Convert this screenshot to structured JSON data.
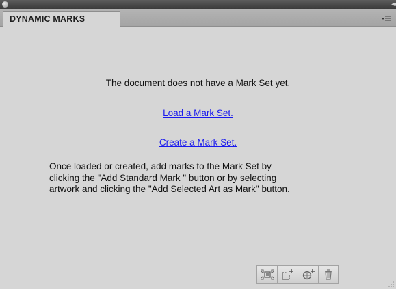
{
  "panel": {
    "tab_title": "DYNAMIC MARKS"
  },
  "content": {
    "message": "The document does not have a Mark Set yet.",
    "load_link": "Load a Mark Set.",
    "create_link": "Create a Mark Set.",
    "info_lines": [
      "Once loaded or created, add marks to the Mark Set by",
      "clicking the \"Add Standard Mark \" button or by selecting",
      "artwork and clicking the \"Add Selected Art as Mark\" button."
    ]
  },
  "toolbar": {
    "buttons": [
      {
        "icon": "fit-marks-icon"
      },
      {
        "icon": "add-standard-mark-icon"
      },
      {
        "icon": "add-selected-art-icon"
      },
      {
        "icon": "trash-icon"
      }
    ]
  },
  "colors": {
    "panel_bg": "#d6d6d6",
    "link": "#1a1aee",
    "titlebar": "#3a3a3a"
  }
}
